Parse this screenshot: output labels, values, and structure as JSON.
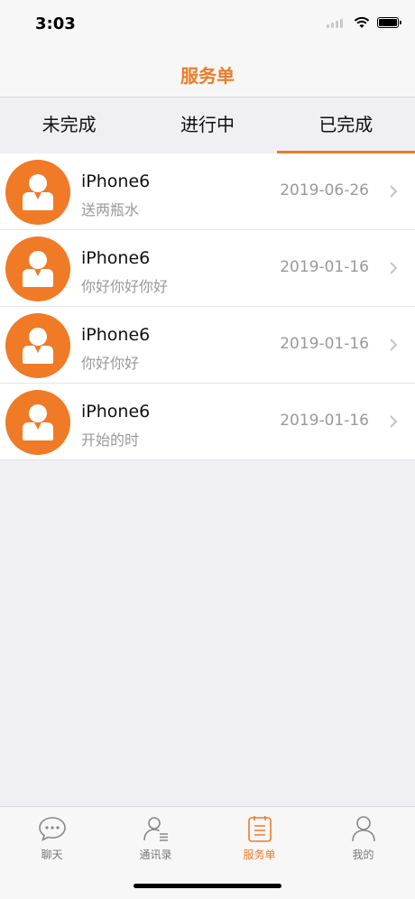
{
  "status": {
    "time": "3:03"
  },
  "nav": {
    "title": "服务单"
  },
  "segments": [
    {
      "label": "未完成"
    },
    {
      "label": "进行中"
    },
    {
      "label": "已完成",
      "active": true
    }
  ],
  "rows": [
    {
      "title": "iPhone6",
      "subtitle": "送两瓶水",
      "date": "2019-06-26"
    },
    {
      "title": "iPhone6",
      "subtitle": "你好你好你好",
      "date": "2019-01-16"
    },
    {
      "title": "iPhone6",
      "subtitle": "你好你好",
      "date": "2019-01-16"
    },
    {
      "title": "iPhone6",
      "subtitle": "开始的时",
      "date": "2019-01-16"
    }
  ],
  "tabs": [
    {
      "label": "聊天",
      "icon": "chat-bubble-icon"
    },
    {
      "label": "通讯录",
      "icon": "contacts-icon"
    },
    {
      "label": "服务单",
      "icon": "service-order-icon",
      "active": true
    },
    {
      "label": "我的",
      "icon": "profile-icon"
    }
  ],
  "colors": {
    "accent": "#f07a26",
    "background": "#efeff4",
    "muted": "#999999"
  }
}
